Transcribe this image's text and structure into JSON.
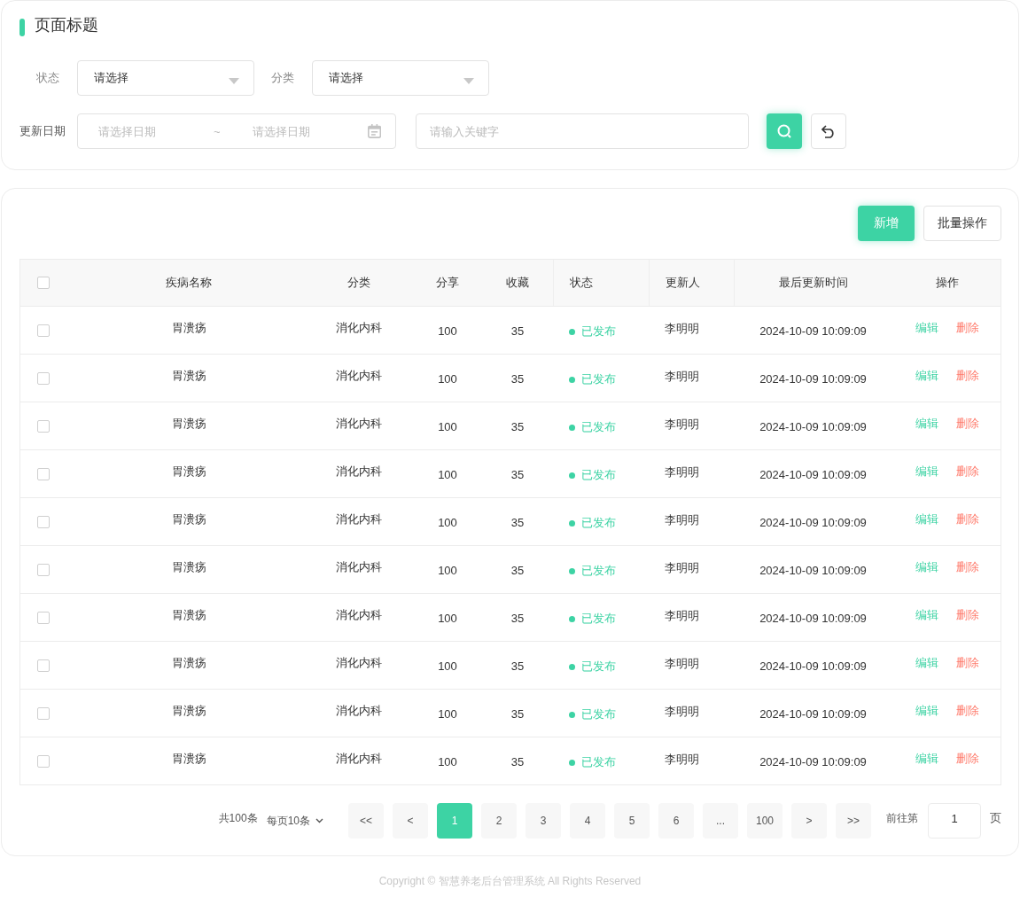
{
  "page_title": "页面标题",
  "filters": {
    "status": {
      "label": "状态",
      "value": "请选择"
    },
    "category": {
      "label": "分类",
      "value": "请选择"
    },
    "date": {
      "label": "更新日期",
      "start_placeholder": "请选择日期",
      "separator": "~",
      "end_placeholder": "请选择日期"
    },
    "keyword": {
      "placeholder": "请输入关键字"
    }
  },
  "toolbar": {
    "add": "新增",
    "batch": "批量操作"
  },
  "table": {
    "header_checked": false,
    "columns": [
      "疾病名称",
      "分类",
      "分享",
      "收藏",
      "状态",
      "更新人",
      "最后更新时间",
      "操作"
    ],
    "rows": [
      {
        "checked": false,
        "name": "胃溃疡",
        "category": "消化内科",
        "shares": "100",
        "favorites": "35",
        "status": "已发布",
        "updater": "李明明",
        "updated": "2024-10-09 10:09:09",
        "actions": [
          "编辑",
          "删除"
        ]
      },
      {
        "checked": false,
        "name": "胃溃疡",
        "category": "消化内科",
        "shares": "100",
        "favorites": "35",
        "status": "已发布",
        "updater": "李明明",
        "updated": "2024-10-09 10:09:09",
        "actions": [
          "编辑",
          "删除"
        ]
      },
      {
        "checked": false,
        "name": "胃溃疡",
        "category": "消化内科",
        "shares": "100",
        "favorites": "35",
        "status": "已发布",
        "updater": "李明明",
        "updated": "2024-10-09 10:09:09",
        "actions": [
          "编辑",
          "删除"
        ]
      },
      {
        "checked": false,
        "name": "胃溃疡",
        "category": "消化内科",
        "shares": "100",
        "favorites": "35",
        "status": "已发布",
        "updater": "李明明",
        "updated": "2024-10-09 10:09:09",
        "actions": [
          "编辑",
          "删除"
        ]
      },
      {
        "checked": false,
        "name": "胃溃疡",
        "category": "消化内科",
        "shares": "100",
        "favorites": "35",
        "status": "已发布",
        "updater": "李明明",
        "updated": "2024-10-09 10:09:09",
        "actions": [
          "编辑",
          "删除"
        ]
      },
      {
        "checked": false,
        "name": "胃溃疡",
        "category": "消化内科",
        "shares": "100",
        "favorites": "35",
        "status": "已发布",
        "updater": "李明明",
        "updated": "2024-10-09 10:09:09",
        "actions": [
          "编辑",
          "删除"
        ]
      },
      {
        "checked": false,
        "name": "胃溃疡",
        "category": "消化内科",
        "shares": "100",
        "favorites": "35",
        "status": "已发布",
        "updater": "李明明",
        "updated": "2024-10-09 10:09:09",
        "actions": [
          "编辑",
          "删除"
        ]
      },
      {
        "checked": false,
        "name": "胃溃疡",
        "category": "消化内科",
        "shares": "100",
        "favorites": "35",
        "status": "已发布",
        "updater": "李明明",
        "updated": "2024-10-09 10:09:09",
        "actions": [
          "编辑",
          "删除"
        ]
      },
      {
        "checked": false,
        "name": "胃溃疡",
        "category": "消化内科",
        "shares": "100",
        "favorites": "35",
        "status": "已发布",
        "updater": "李明明",
        "updated": "2024-10-09 10:09:09",
        "actions": [
          "编辑",
          "删除"
        ]
      },
      {
        "checked": false,
        "name": "胃溃疡",
        "category": "消化内科",
        "shares": "100",
        "favorites": "35",
        "status": "已发布",
        "updater": "李明明",
        "updated": "2024-10-09 10:09:09",
        "actions": [
          "编辑",
          "删除"
        ]
      }
    ]
  },
  "pagination": {
    "total": "共100条",
    "page_size": "每页10条",
    "first": "<<",
    "prev": "<",
    "pages": [
      {
        "label": "1",
        "selected": true
      },
      {
        "label": "2",
        "selected": false
      },
      {
        "label": "3",
        "selected": false
      },
      {
        "label": "4",
        "selected": false
      },
      {
        "label": "5",
        "selected": false
      },
      {
        "label": "6",
        "selected": false
      },
      {
        "label": "...",
        "selected": false
      },
      {
        "label": "100",
        "selected": false
      }
    ],
    "next": ">",
    "last": ">>",
    "goto_label": "前往第",
    "goto_value": "1",
    "goto_suffix": "页"
  },
  "footer": "Copyright © 智慧养老后台管理系统 All Rights Reserved"
}
